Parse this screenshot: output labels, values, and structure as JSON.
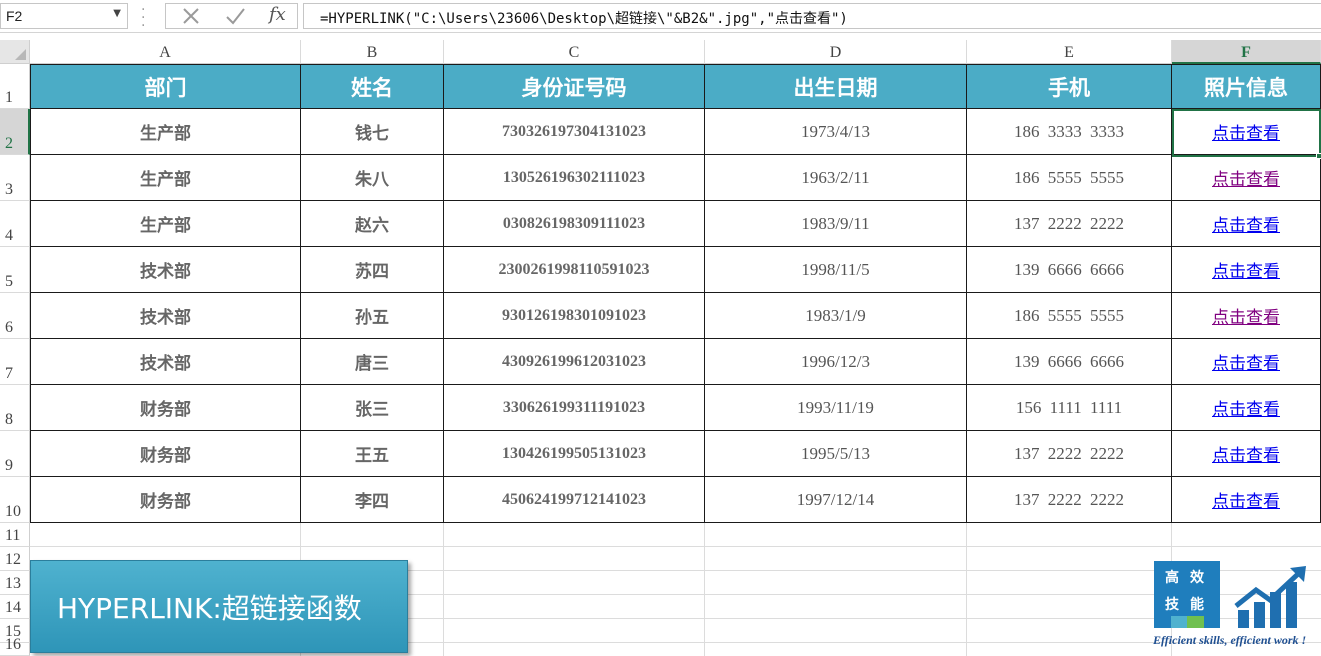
{
  "formula_bar": {
    "name_box": "F2",
    "fx": "fx",
    "formula": "=HYPERLINK(\"C:\\Users\\23606\\Desktop\\超链接\\\"&B2&\".jpg\",\"点击查看\")"
  },
  "columns": [
    "A",
    "B",
    "C",
    "D",
    "E",
    "F"
  ],
  "rows": [
    "1",
    "2",
    "3",
    "4",
    "5",
    "6",
    "7",
    "8",
    "9",
    "10",
    "11",
    "12",
    "13",
    "14",
    "15",
    "16"
  ],
  "selected_cell": "F2",
  "table": {
    "headers": [
      "部门",
      "姓名",
      "身份证号码",
      "出生日期",
      "手机",
      "照片信息"
    ],
    "rows": [
      {
        "dept": "生产部",
        "name": "钱七",
        "id": "730326197304131023",
        "dob": "1973/4/13",
        "phone": "186 3333 3333",
        "link": "点击查看",
        "visited": false
      },
      {
        "dept": "生产部",
        "name": "朱八",
        "id": "130526196302111023",
        "dob": "1963/2/11",
        "phone": "186 5555 5555",
        "link": "点击查看",
        "visited": true
      },
      {
        "dept": "生产部",
        "name": "赵六",
        "id": "030826198309111023",
        "dob": "1983/9/11",
        "phone": "137 2222 2222",
        "link": "点击查看",
        "visited": false
      },
      {
        "dept": "技术部",
        "name": "苏四",
        "id": "2300261998110591023",
        "dob": "1998/11/5",
        "phone": "139 6666 6666",
        "link": "点击查看",
        "visited": false
      },
      {
        "dept": "技术部",
        "name": "孙五",
        "id": "930126198301091023",
        "dob": "1983/1/9",
        "phone": "186 5555 5555",
        "link": "点击查看",
        "visited": true
      },
      {
        "dept": "技术部",
        "name": "唐三",
        "id": "430926199612031023",
        "dob": "1996/12/3",
        "phone": "139 6666 6666",
        "link": "点击查看",
        "visited": false
      },
      {
        "dept": "财务部",
        "name": "张三",
        "id": "330626199311191023",
        "dob": "1993/11/19",
        "phone": "156 1111 1111",
        "link": "点击查看",
        "visited": false
      },
      {
        "dept": "财务部",
        "name": "王五",
        "id": "130426199505131023",
        "dob": "1995/5/13",
        "phone": "137 2222 2222",
        "link": "点击查看",
        "visited": false
      },
      {
        "dept": "财务部",
        "name": "李四",
        "id": "450624199712141023",
        "dob": "1997/12/14",
        "phone": "137 2222 2222",
        "link": "点击查看",
        "visited": false
      }
    ]
  },
  "banner": {
    "text": "HYPERLINK:超链接函数"
  },
  "logo": {
    "chars": [
      "高",
      "效",
      "技",
      "能"
    ],
    "slogan": "Efficient skills, efficient work !",
    "colors": {
      "box": "#1f7ebd",
      "bar": [
        "#1f7ebd",
        "#4fb2cf",
        "#70c050",
        "#1f7ebd"
      ],
      "chart": "#1f6fb0"
    }
  },
  "colors": {
    "header_fill": "#4bacc6",
    "selection": "#217346",
    "link": "#0000ee",
    "visited_link": "#800080"
  }
}
